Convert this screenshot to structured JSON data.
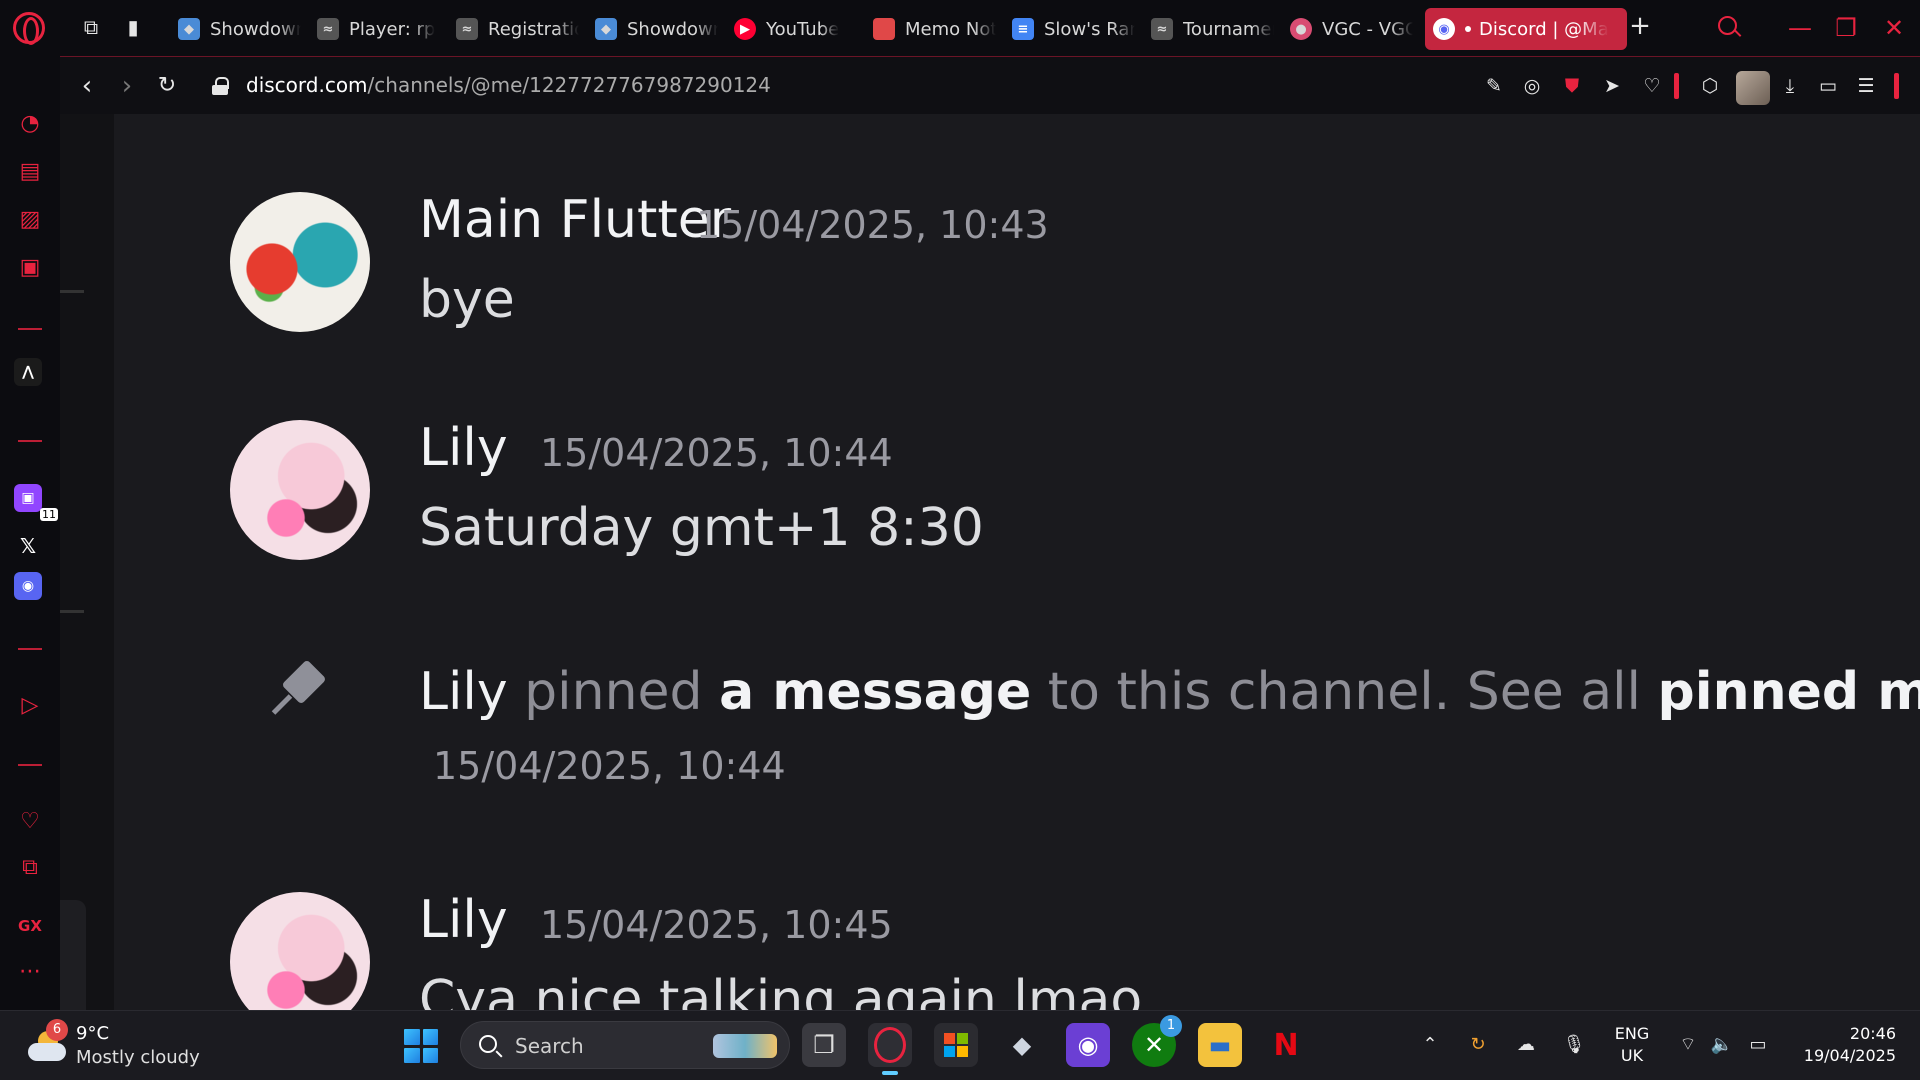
{
  "browser": {
    "tabs": [
      {
        "label": "Showdown!",
        "icon": "showdown-icon",
        "color": "#4a8bd6"
      },
      {
        "label": "Player: rp",
        "icon": "limitless-icon",
        "color": "#b9b9b9"
      },
      {
        "label": "Registration",
        "icon": "limitless-icon",
        "color": "#b9b9b9"
      },
      {
        "label": "Showdown!",
        "icon": "showdown-icon",
        "color": "#4a8bd6"
      },
      {
        "label": "YouTube",
        "icon": "youtube-icon",
        "color": "#ff0033"
      },
      {
        "label": "Memo Notes",
        "icon": "memo-icon",
        "color": "#e04848"
      },
      {
        "label": "Slow's Rankings",
        "icon": "docs-icon",
        "color": "#4285f4"
      },
      {
        "label": "Tournament",
        "icon": "limitless-icon",
        "color": "#b9b9b9"
      },
      {
        "label": "VGC - VGC",
        "icon": "vgc-icon",
        "color": "#d94c72"
      }
    ],
    "active_tab": {
      "label": "Discord | @Ma",
      "icon": "discord-icon"
    },
    "address": {
      "host": "discord.com",
      "path": "/channels/@me/1227727767987290124"
    },
    "accent": "#e8233f"
  },
  "chat": {
    "messages": [
      {
        "author": "Main Flutter",
        "timestamp": "15/04/2025, 10:43",
        "text": "bye"
      },
      {
        "author": "Lily",
        "timestamp": "15/04/2025, 10:44",
        "text": "Saturday gmt+1 8:30"
      }
    ],
    "system": {
      "author": "Lily",
      "pinned": " pinned ",
      "link1": "a message",
      "middle": " to this channel. See all ",
      "link2": "pinned messages",
      "end": ".",
      "timestamp": "15/04/2025, 10:44"
    },
    "last": {
      "author": "Lily",
      "timestamp": "15/04/2025, 10:45",
      "text": "Cya nice talking again lmao"
    }
  },
  "sidebar": {
    "gx_label": "GX",
    "twitch_count": "11"
  },
  "taskbar": {
    "weather_temp": "9°C",
    "weather_desc": "Mostly cloudy",
    "weather_badge": "6",
    "search_label": "Search",
    "xbox_badge": "1",
    "lang_line1": "ENG",
    "lang_line2": "UK",
    "time": "20:46",
    "date": "19/04/2025"
  }
}
